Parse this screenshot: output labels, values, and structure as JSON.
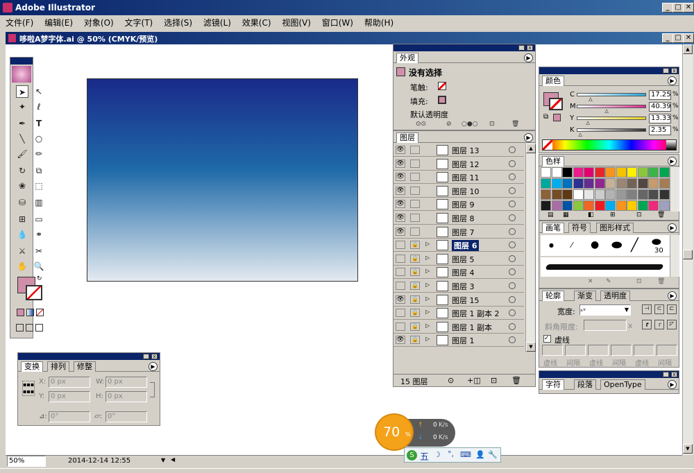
{
  "app": {
    "title": "Adobe Illustrator"
  },
  "menu": [
    "文件(F)",
    "编辑(E)",
    "对象(O)",
    "文字(T)",
    "选择(S)",
    "滤镜(L)",
    "效果(C)",
    "视图(V)",
    "窗口(W)",
    "帮助(H)"
  ],
  "document": {
    "title": "哆啦A梦字体.ai @ 50% (CMYK/预览)",
    "zoom": "50%",
    "datetime": "2014-12-14    12:55"
  },
  "appearance": {
    "tab": "外观",
    "no_selection": "没有选择",
    "stroke_label": "笔触:",
    "fill_label": "填充:",
    "opacity_label": "默认透明度"
  },
  "layers": {
    "tab": "图层",
    "footer": "15 图层",
    "rows": [
      {
        "name": "图层 13",
        "visible": true
      },
      {
        "name": "图层 12",
        "visible": true
      },
      {
        "name": "图层 11",
        "visible": true
      },
      {
        "name": "图层 10",
        "visible": true
      },
      {
        "name": "图层 9",
        "visible": true
      },
      {
        "name": "图层 8",
        "visible": true
      },
      {
        "name": "图层 7",
        "visible": true
      },
      {
        "name": "图层 6",
        "visible": false,
        "selected": true
      },
      {
        "name": "图层 5",
        "visible": false
      },
      {
        "name": "图层 4",
        "visible": false
      },
      {
        "name": "图层 3",
        "visible": false
      },
      {
        "name": "图层 15",
        "visible": true
      },
      {
        "name": "图层 1 副本 2",
        "visible": false
      },
      {
        "name": "图层 1 副本",
        "visible": false
      },
      {
        "name": "图层 1",
        "visible": true
      }
    ]
  },
  "color": {
    "tab": "颜色",
    "channels": [
      {
        "label": "C",
        "value": "17.25",
        "color": "#2aa6d6"
      },
      {
        "label": "M",
        "value": "40.39",
        "color": "#d82a8a"
      },
      {
        "label": "Y",
        "value": "13.33",
        "color": "#e6d21e"
      },
      {
        "label": "K",
        "value": "2.35",
        "color": "#333333"
      }
    ],
    "unit": "%",
    "fill_color": "#cf8fa8"
  },
  "swatches": {
    "tab": "色样",
    "colors": [
      "#ffffff",
      "#ffffff",
      "#000000",
      "#ec1c8c",
      "#e3006f",
      "#e7262a",
      "#f7941d",
      "#f6c300",
      "#fff200",
      "#8cc63f",
      "#39b54a",
      "#00a651",
      "#00a99d",
      "#00aeef",
      "#0072bc",
      "#2e3192",
      "#662d91",
      "#92278f",
      "#c7b299",
      "#998675",
      "#736357",
      "#534741",
      "#c69c6d",
      "#a67c52",
      "#8c6239",
      "#754c24",
      "#603813",
      "#ffffff",
      "#e6e6e6",
      "#cccccc",
      "#b3b3b3",
      "#999999",
      "#808080",
      "#666666",
      "#4d4d4d",
      "#333333",
      "#1a1a1a",
      "#ab6ca8",
      "#0054a6",
      "#8dc63f",
      "#f26522",
      "#ed1c24",
      "#00aeef",
      "#f7941d",
      "#ffcc00",
      "#00a651",
      "#ee2a7b",
      "#a0a0c0",
      "#6dcff6",
      "#3d3d9f",
      "#c1a0d0",
      "#6c3a6c",
      "#f49ac1",
      "#8c6239"
    ]
  },
  "brushes": {
    "tabs": [
      "画笔",
      "符号",
      "图形样式"
    ],
    "size_label": "30"
  },
  "stroke": {
    "tabs": [
      "轮廓",
      "渐变",
      "透明度"
    ],
    "weight_label": "宽度:",
    "miter_label": "斜角限度:",
    "miter_unit": "x",
    "dashed_label": "虚线",
    "dash_labels": [
      "虚线",
      "间隔",
      "虚线",
      "间隔",
      "虚线",
      "间隔"
    ]
  },
  "character": {
    "tabs": [
      "字符",
      "段落",
      "OpenType"
    ]
  },
  "transform": {
    "tabs": [
      "变换",
      "排列",
      "修整"
    ],
    "x_label": "X:",
    "y_label": "Y:",
    "w_label": "W:",
    "h_label": "H:",
    "x": "0 px",
    "y": "0 px",
    "w": "0 px",
    "h": "0 px",
    "rotate": "0°",
    "shear": "0°"
  },
  "netmeter": {
    "percent": "70",
    "unit": "%",
    "up": "0",
    "down": "0",
    "speed_unit": "K/s"
  },
  "ime": {
    "label": "五"
  },
  "gradient": {
    "top": "#1a2a8a",
    "mid": "#1f6aa8",
    "bottom": "#e4eaf0"
  }
}
